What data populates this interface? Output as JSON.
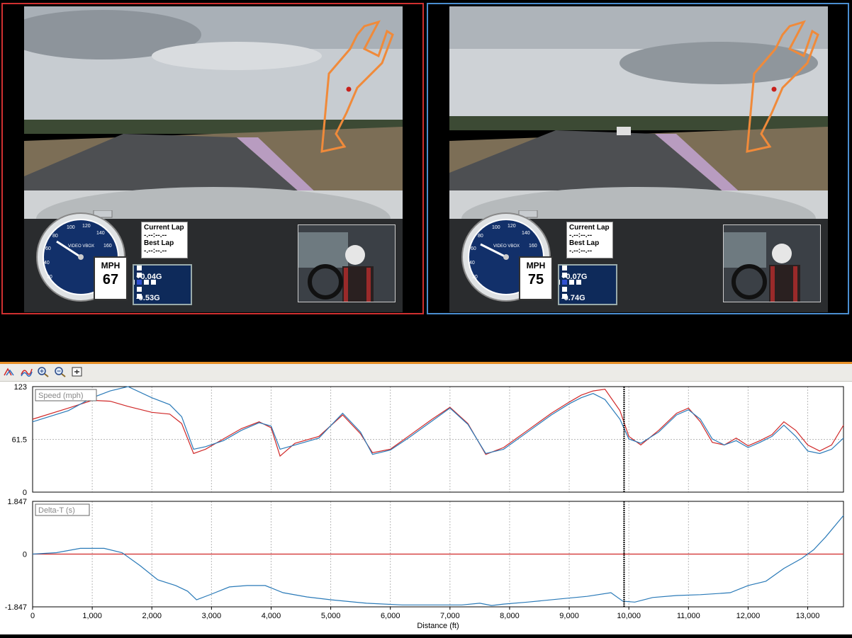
{
  "left_video": {
    "mph_label": "MPH",
    "speed": "67",
    "current_lap_label": "Current Lap",
    "current_lap_value": "-.--:--.--",
    "best_lap_label": "Best Lap",
    "best_lap_value": "-.--:--.--",
    "g_long": "+0.04G",
    "g_lat": "-0.53G",
    "brand": "VIDEO VBOX",
    "border_color": "#d03030"
  },
  "right_video": {
    "mph_label": "MPH",
    "speed": "75",
    "current_lap_label": "Current Lap",
    "current_lap_value": "-.--:--.--",
    "best_lap_label": "Best Lap",
    "best_lap_value": "-.--:--.--",
    "g_long": "+0.07G",
    "g_lat": "-0.74G",
    "brand": "VIDEO VBOX",
    "border_color": "#4a8ed0"
  },
  "gauge_ticks": [
    "20",
    "40",
    "60",
    "80",
    "100",
    "120",
    "140",
    "160"
  ],
  "toolbar": {
    "icons": [
      "graph-a-icon",
      "graph-b-icon",
      "zoom-in-icon",
      "zoom-out-icon",
      "fit-icon"
    ]
  },
  "chart_data": [
    {
      "type": "line",
      "title": "Speed (mph)",
      "y_ticks": [
        "123",
        "61.5",
        "0"
      ],
      "ylim": [
        0,
        123
      ],
      "xlim": [
        0,
        13600
      ],
      "cursor_x": 9920,
      "series": [
        {
          "color": "#d02828",
          "x": [
            0,
            600,
            1000,
            1300,
            1600,
            2000,
            2300,
            2500,
            2700,
            2900,
            3200,
            3500,
            3800,
            4000,
            4150,
            4400,
            4800,
            5200,
            5500,
            5700,
            6000,
            6300,
            6700,
            7000,
            7300,
            7600,
            7900,
            8300,
            8700,
            9000,
            9200,
            9400,
            9600,
            9850,
            10000,
            10200,
            10500,
            10800,
            11000,
            11200,
            11400,
            11600,
            11800,
            12000,
            12200,
            12400,
            12600,
            12800,
            13000,
            13200,
            13400,
            13600
          ],
          "y": [
            85,
            98,
            107,
            106,
            100,
            93,
            91,
            80,
            45,
            50,
            62,
            74,
            82,
            75,
            42,
            57,
            65,
            90,
            68,
            46,
            50,
            65,
            85,
            99,
            80,
            44,
            52,
            72,
            92,
            105,
            113,
            118,
            120,
            95,
            65,
            55,
            72,
            92,
            98,
            82,
            58,
            55,
            63,
            54,
            60,
            67,
            82,
            72,
            55,
            48,
            55,
            78
          ]
        },
        {
          "color": "#2a7ab8",
          "x": [
            0,
            600,
            1000,
            1300,
            1600,
            2000,
            2300,
            2500,
            2700,
            2900,
            3200,
            3500,
            3800,
            4000,
            4150,
            4400,
            4800,
            5200,
            5500,
            5700,
            6000,
            6300,
            6700,
            7000,
            7300,
            7600,
            7900,
            8300,
            8700,
            9000,
            9200,
            9400,
            9600,
            9850,
            10000,
            10200,
            10500,
            10800,
            11000,
            11200,
            11400,
            11600,
            11800,
            12000,
            12200,
            12400,
            12600,
            12800,
            13000,
            13200,
            13400,
            13600
          ],
          "y": [
            82,
            95,
            110,
            118,
            123,
            110,
            102,
            88,
            50,
            53,
            60,
            72,
            81,
            77,
            50,
            55,
            63,
            92,
            70,
            44,
            49,
            63,
            83,
            98,
            79,
            45,
            50,
            70,
            90,
            103,
            110,
            115,
            108,
            85,
            62,
            57,
            70,
            90,
            96,
            85,
            62,
            55,
            60,
            52,
            58,
            65,
            78,
            65,
            48,
            45,
            50,
            63
          ]
        }
      ]
    },
    {
      "type": "line",
      "title": "Delta-T (s)",
      "y_ticks": [
        "1.847",
        "0",
        "-1.847"
      ],
      "ylim": [
        -1.847,
        1.847
      ],
      "xlim": [
        0,
        13600
      ],
      "xlabel": "Distance (ft)",
      "x_ticks": [
        "0",
        "1,000",
        "2,000",
        "3,000",
        "4,000",
        "5,000",
        "6,000",
        "7,000",
        "8,000",
        "9,000",
        "10,000",
        "11,000",
        "12,000",
        "13,000"
      ],
      "x_values": [
        0,
        1000,
        2000,
        3000,
        4000,
        5000,
        6000,
        7000,
        8000,
        9000,
        10000,
        11000,
        12000,
        13000
      ],
      "series": [
        {
          "color": "#d02828",
          "x": [
            0,
            13600
          ],
          "y": [
            0,
            0
          ]
        },
        {
          "color": "#2a7ab8",
          "x": [
            0,
            400,
            800,
            1200,
            1500,
            1800,
            2100,
            2400,
            2600,
            2750,
            3000,
            3300,
            3600,
            3900,
            4200,
            4600,
            5000,
            5600,
            6200,
            6800,
            7200,
            7500,
            7700,
            7900,
            8300,
            8800,
            9300,
            9700,
            9900,
            10100,
            10400,
            10800,
            11200,
            11500,
            11700,
            12000,
            12300,
            12600,
            12900,
            13100,
            13300,
            13600
          ],
          "y": [
            0,
            0.05,
            0.2,
            0.2,
            0.05,
            -0.4,
            -0.9,
            -1.1,
            -1.3,
            -1.6,
            -1.4,
            -1.15,
            -1.1,
            -1.1,
            -1.35,
            -1.5,
            -1.6,
            -1.72,
            -1.78,
            -1.78,
            -1.78,
            -1.72,
            -1.8,
            -1.75,
            -1.68,
            -1.58,
            -1.48,
            -1.35,
            -1.65,
            -1.68,
            -1.52,
            -1.45,
            -1.42,
            -1.38,
            -1.35,
            -1.1,
            -0.95,
            -0.5,
            -0.15,
            0.15,
            0.6,
            1.35
          ]
        }
      ]
    }
  ]
}
